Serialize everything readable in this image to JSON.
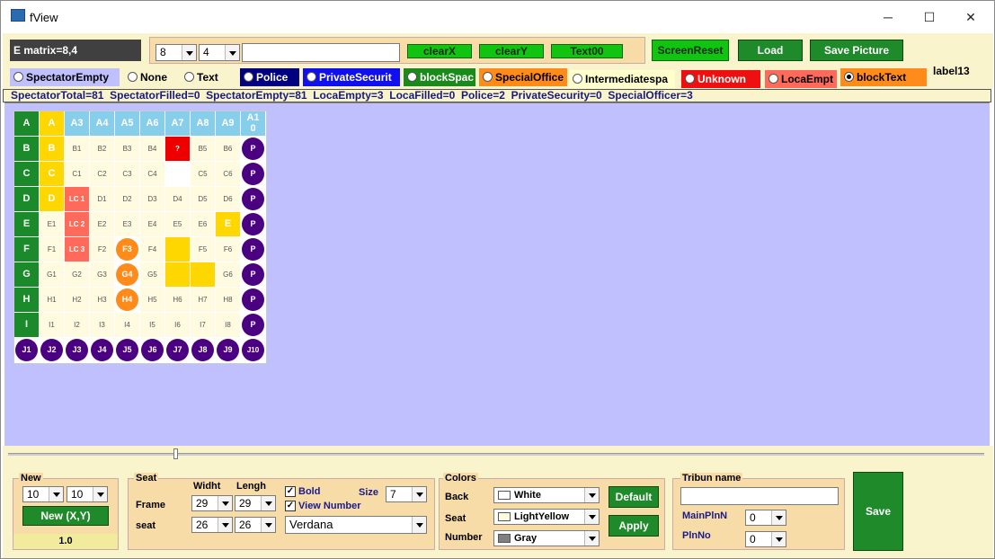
{
  "window": {
    "title": "fView",
    "minimize": "─",
    "maximize": "☐",
    "close": "✕"
  },
  "toolbar": {
    "matrix_label": "E matrix=8,4",
    "sel_x": "8",
    "sel_y": "4",
    "text_input": "",
    "clearX": "clearX",
    "clearY": "clearY",
    "text00": "Text00",
    "screen_reset": "ScreenReset",
    "load": "Load",
    "save_picture": "Save Picture",
    "label13": "label13"
  },
  "radios": [
    {
      "label": "SpectatorEmpty",
      "bg": "#c0c0ff",
      "color": "#000",
      "checked": false
    },
    {
      "label": "None",
      "bg": "#f9f4cc",
      "color": "#000",
      "checked": false
    },
    {
      "label": "Text",
      "bg": "#f9f4cc",
      "color": "#000",
      "checked": false
    },
    {
      "label": "Police",
      "bg": "#000080",
      "color": "#fff",
      "checked": false
    },
    {
      "label": "PrivateSecurit",
      "bg": "#1010ee",
      "color": "#fff",
      "checked": false
    },
    {
      "label": "blockSpac",
      "bg": "#1a8a1a",
      "color": "#fff",
      "checked": false
    },
    {
      "label": "SpecialOffice",
      "bg": "#ff8c1a",
      "color": "#000",
      "checked": false
    },
    {
      "label": "Intermediatespa",
      "bg": "#ffffcc",
      "color": "#000",
      "checked": false
    },
    {
      "label": "Unknown",
      "bg": "#ee1010",
      "color": "#fff",
      "checked": false
    },
    {
      "label": "LocaEmpt",
      "bg": "#ff6a5a",
      "color": "#000",
      "checked": false
    },
    {
      "label": "blockText",
      "bg": "#ff8c1a",
      "color": "#000",
      "checked": true
    }
  ],
  "status": "SpectatorTotal=81  SpectatorFilled=0  SpectatorEmpty=81  LocaEmpty=3  LocaFilled=0  Police=2  PrivateSecurity=0  SpecialOfficer=3",
  "grid": {
    "colors": {
      "green": "#1a8a2a",
      "yellow": "#ffd700",
      "blue": "#87ceeb",
      "red": "#ee0000",
      "salmon": "#ff6a5a",
      "orange": "#ff8c1a",
      "purple": "#4b0082",
      "cream": "#fffbe0",
      "white": "#ffffff"
    },
    "rows": [
      [
        [
          "A",
          "green"
        ],
        [
          "A",
          "yellow"
        ],
        [
          "A3",
          "blue"
        ],
        [
          "A4",
          "blue"
        ],
        [
          "A5",
          "blue"
        ],
        [
          "A6",
          "blue"
        ],
        [
          "A7",
          "blue"
        ],
        [
          "A8",
          "blue"
        ],
        [
          "A9",
          "blue"
        ],
        [
          "A10",
          "blue"
        ]
      ],
      [
        [
          "B",
          "green"
        ],
        [
          "B",
          "yellow"
        ],
        [
          "B1",
          "cream"
        ],
        [
          "B2",
          "cream"
        ],
        [
          "B3",
          "cream"
        ],
        [
          "B4",
          "cream"
        ],
        [
          "?",
          "red"
        ],
        [
          "B5",
          "cream"
        ],
        [
          "B6",
          "cream"
        ],
        [
          "P",
          "purple"
        ]
      ],
      [
        [
          "C",
          "green"
        ],
        [
          "C",
          "yellow"
        ],
        [
          "C1",
          "cream"
        ],
        [
          "C2",
          "cream"
        ],
        [
          "C3",
          "cream"
        ],
        [
          "C4",
          "cream"
        ],
        [
          "",
          "white"
        ],
        [
          "C5",
          "cream"
        ],
        [
          "C6",
          "cream"
        ],
        [
          "P",
          "purple"
        ]
      ],
      [
        [
          "D",
          "green"
        ],
        [
          "D",
          "yellow"
        ],
        [
          "LC 1",
          "salmon"
        ],
        [
          "D1",
          "cream"
        ],
        [
          "D2",
          "cream"
        ],
        [
          "D3",
          "cream"
        ],
        [
          "D4",
          "cream"
        ],
        [
          "D5",
          "cream"
        ],
        [
          "D6",
          "cream"
        ],
        [
          "P",
          "purple"
        ]
      ],
      [
        [
          "E",
          "green"
        ],
        [
          "E1",
          "cream"
        ],
        [
          "LC 2",
          "salmon"
        ],
        [
          "E2",
          "cream"
        ],
        [
          "E3",
          "cream"
        ],
        [
          "E4",
          "cream"
        ],
        [
          "E5",
          "cream"
        ],
        [
          "E6",
          "cream"
        ],
        [
          "E",
          "yellow"
        ],
        [
          "P",
          "purple"
        ]
      ],
      [
        [
          "F",
          "green"
        ],
        [
          "F1",
          "cream"
        ],
        [
          "LC 3",
          "salmon"
        ],
        [
          "F2",
          "cream"
        ],
        [
          "F3",
          "orange"
        ],
        [
          "F4",
          "cream"
        ],
        [
          "",
          "yellow"
        ],
        [
          "F5",
          "cream"
        ],
        [
          "F6",
          "cream"
        ],
        [
          "P",
          "purple"
        ]
      ],
      [
        [
          "G",
          "green"
        ],
        [
          "G1",
          "cream"
        ],
        [
          "G2",
          "cream"
        ],
        [
          "G3",
          "cream"
        ],
        [
          "G4",
          "orange"
        ],
        [
          "G5",
          "cream"
        ],
        [
          "",
          "yellow"
        ],
        [
          "",
          "yellow"
        ],
        [
          "G6",
          "cream"
        ],
        [
          "P",
          "purple"
        ]
      ],
      [
        [
          "H",
          "green"
        ],
        [
          "H1",
          "cream"
        ],
        [
          "H2",
          "cream"
        ],
        [
          "H3",
          "cream"
        ],
        [
          "H4",
          "orange"
        ],
        [
          "H5",
          "cream"
        ],
        [
          "H6",
          "cream"
        ],
        [
          "H7",
          "cream"
        ],
        [
          "H8",
          "cream"
        ],
        [
          "P",
          "purple"
        ]
      ],
      [
        [
          "I",
          "green"
        ],
        [
          "I1",
          "cream"
        ],
        [
          "I2",
          "cream"
        ],
        [
          "I3",
          "cream"
        ],
        [
          "I4",
          "cream"
        ],
        [
          "I5",
          "cream"
        ],
        [
          "I6",
          "cream"
        ],
        [
          "I7",
          "cream"
        ],
        [
          "I8",
          "cream"
        ],
        [
          "P",
          "purple"
        ]
      ],
      [
        [
          "J1",
          "purple"
        ],
        [
          "J2",
          "purple"
        ],
        [
          "J3",
          "purple"
        ],
        [
          "J4",
          "purple"
        ],
        [
          "J5",
          "purple"
        ],
        [
          "J6",
          "purple"
        ],
        [
          "J7",
          "purple"
        ],
        [
          "J8",
          "purple"
        ],
        [
          "J9",
          "purple"
        ],
        [
          "J10",
          "purple"
        ]
      ]
    ]
  },
  "slider": {
    "value": 0
  },
  "new_group": {
    "title": "New",
    "rows": "10",
    "cols": "10",
    "button": "New (X,Y)",
    "zoom": "1.0"
  },
  "seat_group": {
    "title": "Seat",
    "widht": "Widht",
    "lengh": "Lengh",
    "frame": "Frame",
    "seat": "seat",
    "frame_w": "29",
    "frame_l": "29",
    "seat_w": "26",
    "seat_l": "26",
    "bold": "Bold",
    "view_number": "View Number",
    "size_label": "Size",
    "size": "7",
    "font": "Verdana"
  },
  "colors_group": {
    "title": "Colors",
    "back": "Back",
    "seat": "Seat",
    "number": "Number",
    "back_val": "White",
    "seat_val": "LightYellow",
    "number_val": "Gray",
    "default": "Default",
    "apply": "Apply"
  },
  "tribun_group": {
    "title": "Tribun name",
    "name": "",
    "main_pln": "MainPlnN",
    "main_val": "0",
    "pln_no": "PlnNo",
    "pln_val": "0"
  },
  "save": "Save"
}
